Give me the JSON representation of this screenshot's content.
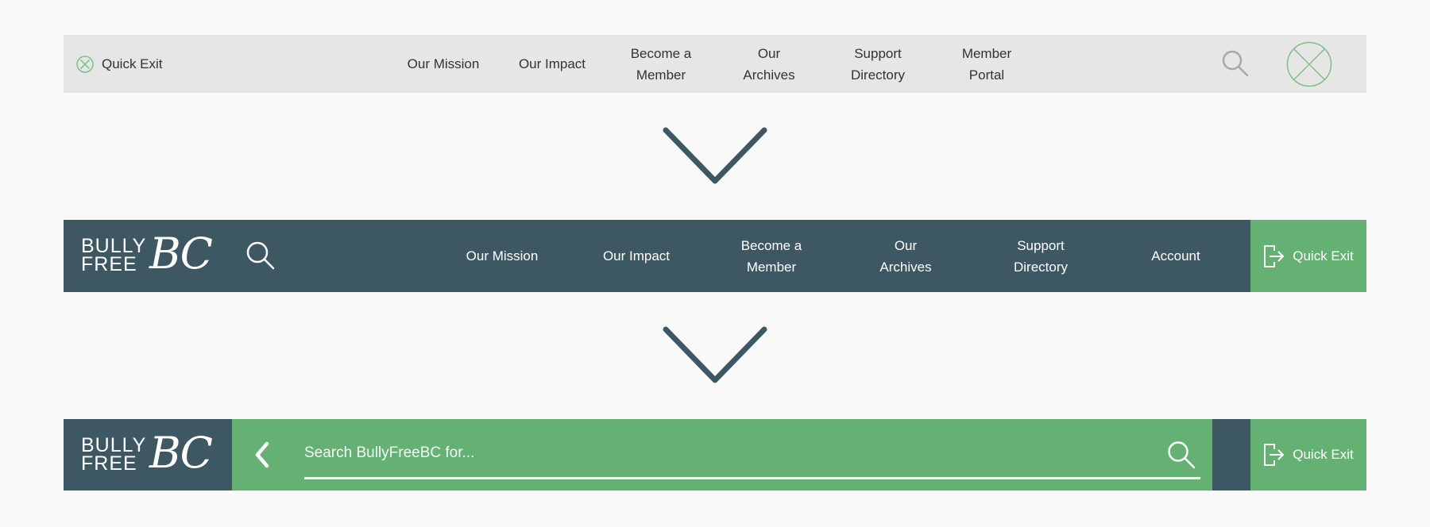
{
  "colors": {
    "background": "#f9f9f9",
    "wireframe_bar": "#e6e6e6",
    "dark_teal": "#3d5863",
    "brand_green": "#65b174",
    "wireframe_green": "#7cbf8a"
  },
  "wireframe_bar": {
    "quick_exit_icon": "circle-x-icon",
    "quick_exit_label": "Quick Exit",
    "nav": [
      {
        "l1": "Our Mission",
        "l2": ""
      },
      {
        "l1": "Our Impact",
        "l2": ""
      },
      {
        "l1": "Become a",
        "l2": "Member"
      },
      {
        "l1": "Our",
        "l2": "Archives"
      },
      {
        "l1": "Support",
        "l2": "Directory"
      },
      {
        "l1": "Member",
        "l2": "Portal"
      }
    ],
    "search_icon": "search-icon",
    "close_icon": "circle-x-icon"
  },
  "arrow_icon": "chevron-down-icon",
  "header_bar": {
    "logo": {
      "line1": "BULLY",
      "line2": "FREE",
      "script": "BC"
    },
    "search_icon": "search-icon",
    "nav": [
      {
        "l1": "Our Mission",
        "l2": ""
      },
      {
        "l1": "Our Impact",
        "l2": ""
      },
      {
        "l1": "Become a",
        "l2": "Member"
      },
      {
        "l1": "Our",
        "l2": "Archives"
      },
      {
        "l1": "Support",
        "l2": "Directory"
      },
      {
        "l1": "Account",
        "l2": ""
      }
    ],
    "quick_exit_icon": "exit-door-icon",
    "quick_exit_label": "Quick Exit"
  },
  "search_bar": {
    "logo": {
      "line1": "BULLY",
      "line2": "FREE",
      "script": "BC"
    },
    "back_icon": "chevron-left-icon",
    "placeholder": "Search BullyFreeBC for...",
    "search_icon": "search-icon",
    "quick_exit_icon": "exit-door-icon",
    "quick_exit_label": "Quick Exit"
  }
}
